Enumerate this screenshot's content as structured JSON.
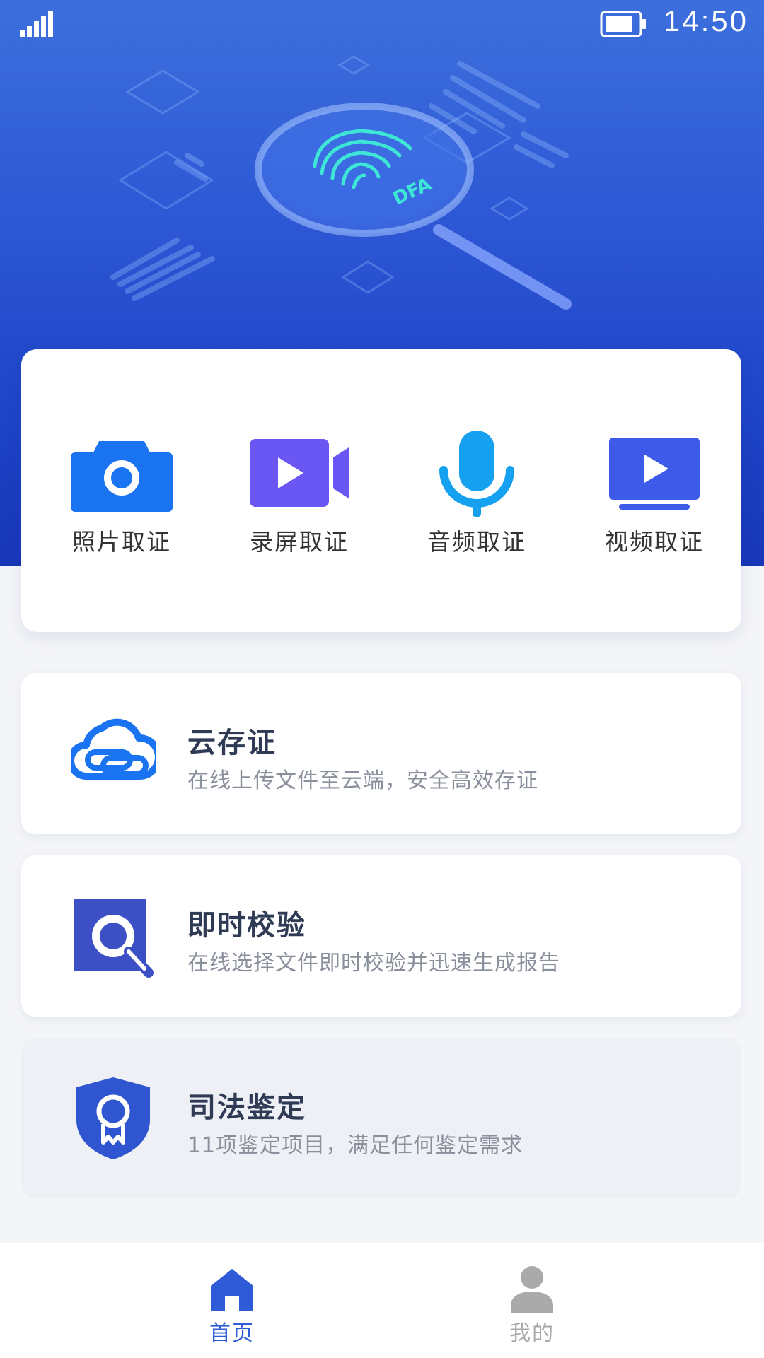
{
  "status_bar": {
    "time": "14:50",
    "signal_icon": "signal-icon",
    "battery_icon": "battery-icon"
  },
  "hero": {
    "logo_text": "DFA"
  },
  "quick_actions": [
    {
      "label": "照片取证",
      "icon": "camera-icon",
      "color": "#1a73f0"
    },
    {
      "label": "录屏取证",
      "icon": "screen-record-icon",
      "color": "#6a56f2"
    },
    {
      "label": "音频取证",
      "icon": "microphone-icon",
      "color": "#16a0f0"
    },
    {
      "label": "视频取证",
      "icon": "video-icon",
      "color": "#3d5be8"
    }
  ],
  "features": [
    {
      "title": "云存证",
      "description": "在线上传文件至云端，安全高效存证",
      "icon": "cloud-icon"
    },
    {
      "title": "即时校验",
      "description": "在线选择文件即时校验并迅速生成报告",
      "icon": "search-check-icon"
    },
    {
      "title": "司法鉴定",
      "description": "11项鉴定项目，满足任何鉴定需求",
      "icon": "shield-badge-icon"
    }
  ],
  "tabbar": {
    "tabs": [
      {
        "label": "首页",
        "icon": "home-icon",
        "active": true
      },
      {
        "label": "我的",
        "icon": "user-icon",
        "active": false
      }
    ],
    "active_color": "#2f5bd6",
    "inactive_color": "#aaaaaa"
  }
}
